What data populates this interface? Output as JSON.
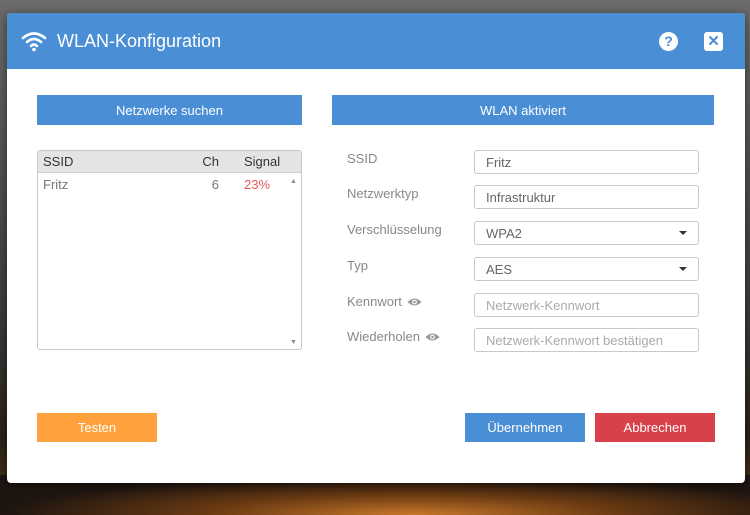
{
  "window": {
    "title": "WLAN-Konfiguration",
    "help_label": "?",
    "close_label": "✕"
  },
  "left_panel": {
    "header": "Netzwerke suchen",
    "columns": {
      "ssid": "SSID",
      "ch": "Ch",
      "signal": "Signal"
    },
    "networks": [
      {
        "ssid": "Fritz",
        "ch": "6",
        "signal": "23%"
      }
    ]
  },
  "right_panel": {
    "header": "WLAN aktiviert",
    "fields": {
      "ssid": {
        "label": "SSID",
        "value": "Fritz"
      },
      "network_type": {
        "label": "Netzwerktyp",
        "value": "Infrastruktur"
      },
      "encryption": {
        "label": "Verschlüsselung",
        "value": "WPA2"
      },
      "type": {
        "label": "Typ",
        "value": "AES"
      },
      "password": {
        "label": "Kennwort",
        "placeholder": "Netzwerk-Kennwort"
      },
      "repeat": {
        "label": "Wiederholen",
        "placeholder": "Netzwerk-Kennwort bestätigen"
      }
    }
  },
  "buttons": {
    "test": "Testen",
    "apply": "Übernehmen",
    "cancel": "Abbrechen"
  },
  "colors": {
    "accent": "#4a8ed6",
    "test": "#ffa13d",
    "cancel": "#d9414a",
    "signal": "#e85a5a"
  }
}
